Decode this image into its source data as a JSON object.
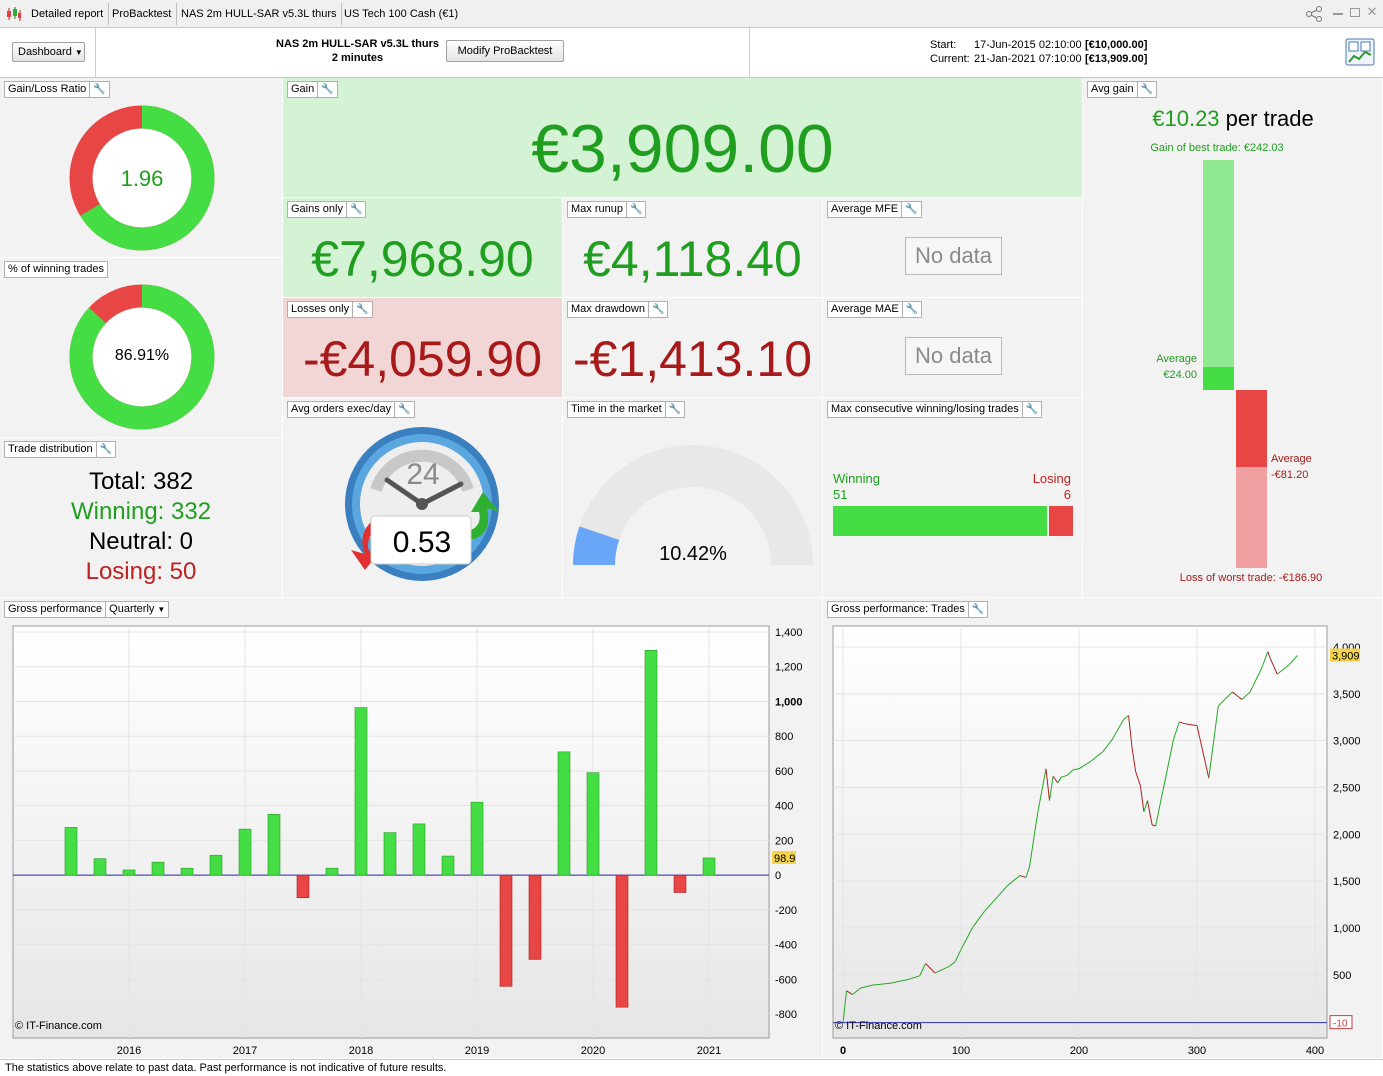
{
  "tabs": {
    "detailed_report": "Detailed report",
    "probacktest": "ProBacktest",
    "strategy": "NAS 2m HULL-SAR v5.3L thurs",
    "instrument": "US Tech 100 Cash (€1)"
  },
  "header": {
    "dashboard_label": "Dashboard",
    "strategy_name": "NAS 2m HULL-SAR v5.3L thurs",
    "timeframe": "2 minutes",
    "modify_label": "Modify ProBacktest",
    "start_label": "Start:",
    "start_date": "17-Jun-2015 02:10:00",
    "start_value": "[€10,000.00]",
    "current_label": "Current:",
    "current_date": "21-Jan-2021 07:10:00",
    "current_value": "[€13,909.00]"
  },
  "panels": {
    "gain_loss_ratio": {
      "title": "Gain/Loss Ratio",
      "value": "1.96",
      "fraction": 0.662
    },
    "winning_pct": {
      "title": "% of winning trades",
      "value": "86.91%",
      "fraction": 0.8691
    },
    "trade_distribution": {
      "title": "Trade distribution",
      "total_label": "Total:",
      "total": "382",
      "winning_label": "Winning:",
      "winning": "332",
      "neutral_label": "Neutral:",
      "neutral": "0",
      "losing_label": "Losing:",
      "losing": "50"
    },
    "gain": {
      "title": "Gain",
      "value": "€3,909.00"
    },
    "gains_only": {
      "title": "Gains only",
      "value": "€7,968.90"
    },
    "losses_only": {
      "title": "Losses only",
      "value": "-€4,059.90"
    },
    "max_runup": {
      "title": "Max runup",
      "value": "€4,118.40"
    },
    "max_drawdown": {
      "title": "Max drawdown",
      "value": "-€1,413.10"
    },
    "avg_mfe": {
      "title": "Average MFE",
      "value": "No data"
    },
    "avg_mae": {
      "title": "Average MAE",
      "value": "No data"
    },
    "avg_orders": {
      "title": "Avg orders exec/day",
      "value": "0.53",
      "dial": "24"
    },
    "time_in_market": {
      "title": "Time in the market",
      "value": "10.42%",
      "fraction": 0.1042
    },
    "max_consecutive": {
      "title": "Max consecutive winning/losing trades",
      "winning_label": "Winning",
      "winning": "51",
      "losing_label": "Losing",
      "losing": "6"
    },
    "avg_gain": {
      "title": "Avg gain",
      "value": "€10.23",
      "suffix": "per trade",
      "best_trade_label": "Gain of best trade: €242.03",
      "avg_win_label": "Average",
      "avg_win_value": "€24.00",
      "avg_loss_label": "Average",
      "avg_loss_value": "-€81.20",
      "worst_trade_label": "Loss of worst trade: -€186.90",
      "best_trade": 242.03,
      "avg_win": 24.0,
      "avg_loss": -81.2,
      "worst_trade": -186.9
    }
  },
  "chart_data": [
    {
      "type": "bar",
      "title": "Gross performance",
      "period_label": "Quarterly",
      "credit": "© IT-Finance.com",
      "x_ticks": [
        "2016",
        "2017",
        "2018",
        "2019",
        "2020",
        "2021"
      ],
      "y_ticks": [
        "1,400",
        "1,200",
        "1,000",
        "800",
        "600",
        "400",
        "200",
        "0",
        "-200",
        "-400",
        "-600",
        "-800"
      ],
      "ylim": [
        -880,
        1400
      ],
      "last_value_label": "98.9",
      "categories": [
        "2015 Q3",
        "2015 Q4",
        "2016 Q1",
        "2016 Q2",
        "2016 Q3",
        "2016 Q4",
        "2017 Q1",
        "2017 Q2",
        "2017 Q3",
        "2017 Q4",
        "2018 Q1",
        "2018 Q2",
        "2018 Q3",
        "2018 Q4",
        "2019 Q1",
        "2019 Q2",
        "2019 Q3",
        "2019 Q4",
        "2020 Q1",
        "2020 Q2",
        "2020 Q3",
        "2020 Q4",
        "2021 Q1"
      ],
      "values": [
        275,
        95,
        30,
        75,
        40,
        115,
        265,
        350,
        -130,
        40,
        965,
        245,
        295,
        110,
        420,
        -640,
        -485,
        710,
        590,
        -760,
        1295,
        -100,
        99
      ]
    },
    {
      "type": "line",
      "title": "Gross performance: Trades",
      "credit": "© IT-Finance.com",
      "x_ticks": [
        "0",
        "100",
        "200",
        "300",
        "400"
      ],
      "y_ticks": [
        "4,000",
        "3,500",
        "3,000",
        "2,500",
        "2,000",
        "1,500",
        "1,000",
        "500"
      ],
      "xlim": [
        0,
        400
      ],
      "ylim": [
        -110,
        4160
      ],
      "last_value_label": "3,909",
      "zero_value_label": "-10",
      "x": [
        0,
        3,
        8,
        15,
        25,
        40,
        55,
        65,
        70,
        78,
        90,
        95,
        100,
        110,
        120,
        140,
        150,
        155,
        158,
        165,
        172,
        175,
        178,
        182,
        185,
        190,
        195,
        200,
        210,
        220,
        228,
        233,
        238,
        242,
        245,
        248,
        252,
        255,
        258,
        262,
        265,
        270,
        275,
        280,
        285,
        290,
        300,
        310,
        318,
        330,
        335,
        338,
        345,
        350,
        355,
        360,
        362,
        368,
        375,
        378,
        385
      ],
      "y": [
        -10,
        330,
        290,
        360,
        390,
        410,
        450,
        490,
        620,
        520,
        590,
        640,
        770,
        1010,
        1180,
        1460,
        1560,
        1540,
        1650,
        2230,
        2700,
        2360,
        2620,
        2550,
        2610,
        2630,
        2690,
        2700,
        2780,
        2880,
        3010,
        3120,
        3230,
        3270,
        2920,
        2670,
        2520,
        2240,
        2360,
        2100,
        2090,
        2400,
        2700,
        3010,
        3200,
        3180,
        3160,
        2600,
        3370,
        3520,
        3470,
        3440,
        3520,
        3650,
        3780,
        3950,
        3880,
        3710,
        3780,
        3810,
        3909
      ]
    }
  ]
}
